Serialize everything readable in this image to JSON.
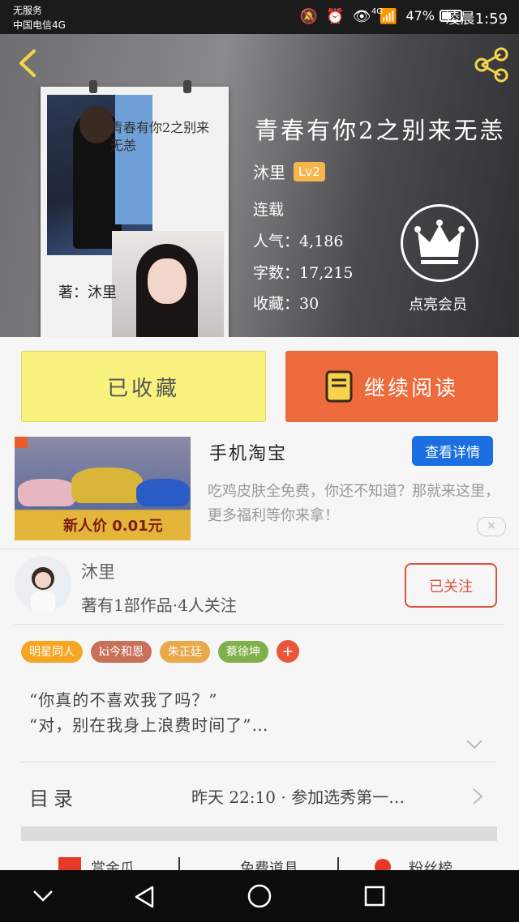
{
  "status_bar": {
    "carrier_line1": "无服务",
    "carrier_line2": "中国电信4G",
    "network": "4G",
    "battery_percent": "47%",
    "time": "凌晨1:59"
  },
  "book": {
    "title": "青春有你2之别来无恙",
    "author": "沐里",
    "author_level": "Lv2",
    "status": "连载",
    "popularity_label": "人气：",
    "popularity_value": "4,186",
    "word_count_label": "字数：",
    "word_count_value": "17,215",
    "favorites_label": "收藏：",
    "favorites_value": "30",
    "vip_label": "点亮会员",
    "cover_title": "青春有你2之别来无恙",
    "cover_author": "著：沐里"
  },
  "actions": {
    "collected_label": "已收藏",
    "continue_reading_label": "继续阅读"
  },
  "ad": {
    "brand": "手机淘宝",
    "detail_button": "查看详情",
    "description": "吃鸡皮肤全免费，你还不知道？那就来这里，更多福利等你来拿！",
    "image_price_text": "新人价 0.01元",
    "close_icon": "×"
  },
  "author_card": {
    "name": "沐里",
    "stats": "著有1部作品·4人关注",
    "follow_label": "已关注"
  },
  "tags": [
    {
      "label": "明星同人",
      "color": "#f5a623"
    },
    {
      "label": "ki今和恩",
      "color": "#c87158"
    },
    {
      "label": "朱正廷",
      "color": "#e8a94a"
    },
    {
      "label": "蔡徐坤",
      "color": "#7fb04a"
    }
  ],
  "tag_add": "+",
  "summary": {
    "line1": "“你真的不喜欢我了吗？”",
    "line2": "“对，别在我身上浪费时间了”…"
  },
  "toc": {
    "label": "目录",
    "latest_chapter": "昨天 22:10 · 参加选秀第一…"
  },
  "bottom_tabs": [
    "赏金瓜",
    "免费道具",
    "粉丝榜"
  ],
  "colors": {
    "accent_orange": "#ed6a3c",
    "collected_yellow": "#f9f27e",
    "detail_blue": "#1b6fe0",
    "follow_red": "#d9533e"
  }
}
